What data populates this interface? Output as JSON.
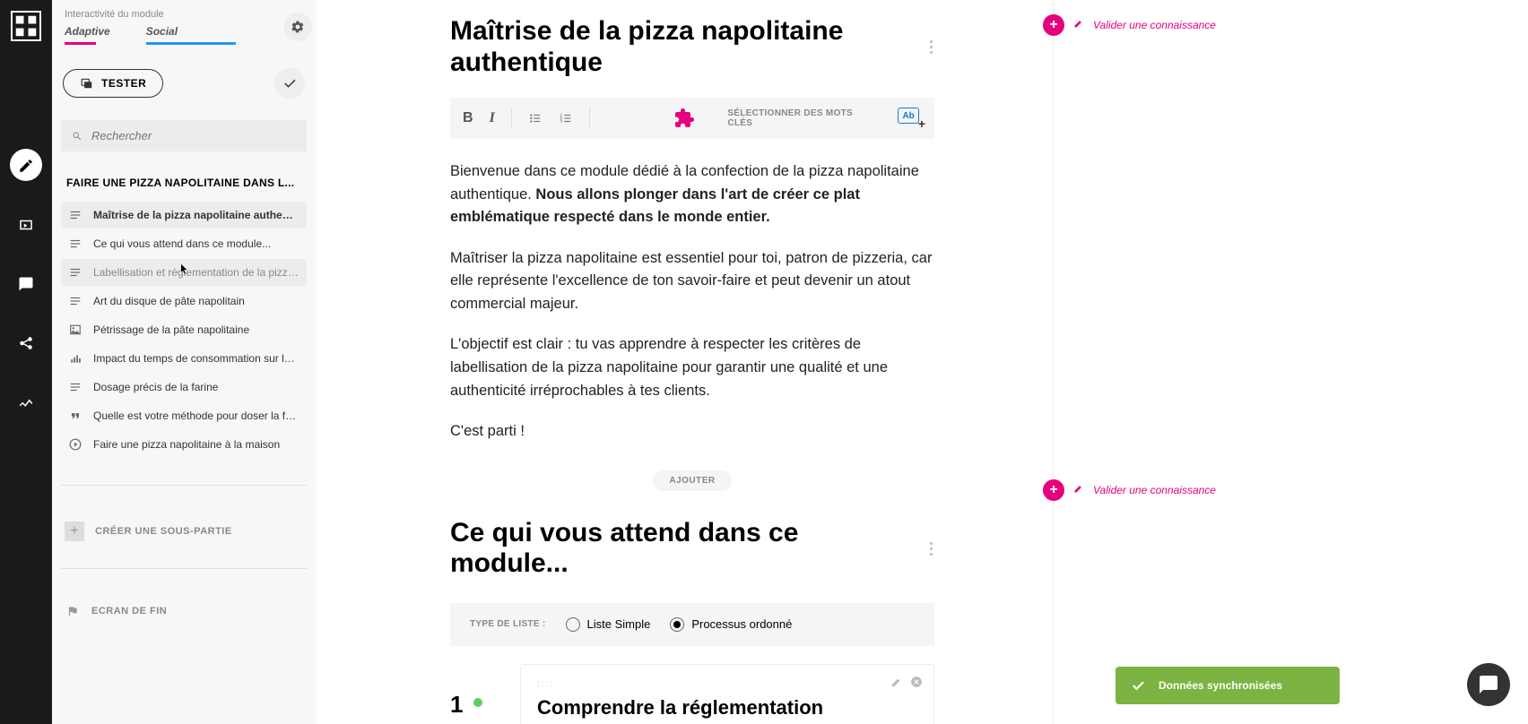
{
  "sidebar": {
    "interactivity_label": "Interactivité du module",
    "tabs": {
      "adaptive": "Adaptive",
      "social": "Social"
    },
    "tester_label": "TESTER",
    "search_placeholder": "Rechercher",
    "section_title": "FAIRE UNE PIZZA NAPOLITAINE DANS L...",
    "items": [
      {
        "label": "Maîtrise de la pizza napolitaine authentique",
        "icon": "text"
      },
      {
        "label": "Ce qui vous attend dans ce module...",
        "icon": "text"
      },
      {
        "label": "Labellisation et réglementation de la pizza n...",
        "icon": "text"
      },
      {
        "label": "Art du disque de pâte napolitain",
        "icon": "text"
      },
      {
        "label": "Pétrissage de la pâte napolitaine",
        "icon": "image"
      },
      {
        "label": "Impact du temps de consommation sur la piz...",
        "icon": "chart"
      },
      {
        "label": "Dosage précis de la farine",
        "icon": "text"
      },
      {
        "label": "Quelle est votre méthode pour doser la farine ?",
        "icon": "quote"
      },
      {
        "label": "Faire une pizza napolitaine à la maison",
        "icon": "play"
      }
    ],
    "create_subpart": "CRÉER UNE SOUS-PARTIE",
    "end_screen": "ECRAN DE FIN"
  },
  "main": {
    "block1": {
      "title": "Maîtrise de la pizza napolitaine authentique",
      "toolbar": {
        "select_keywords": "SÉLECTIONNER DES MOTS CLÉS",
        "hl_text": "Ab"
      },
      "para1_a": "Bienvenue dans ce module dédié à la confection de la pizza napolitaine authentique. ",
      "para1_b": "Nous allons plonger dans l'art de créer ce plat emblématique respecté dans le monde entier.",
      "para2": "Maîtriser la pizza napolitaine est essentiel pour toi, patron de pizzeria, car elle représente l'excellence de ton savoir-faire et peut devenir un atout commercial majeur.",
      "para3": "L'objectif est clair : tu vas apprendre à respecter les critères de labellisation de la pizza napolitaine pour garantir une qualité et une authenticité irréprochables à tes clients.",
      "para4": "C'est parti !"
    },
    "ajouter": "AJOUTER",
    "block2": {
      "title": "Ce qui vous attend dans ce module...",
      "list_type_label": "TYPE DE LISTE :",
      "opt1": "Liste Simple",
      "opt2": "Processus ordonné",
      "step_num": "1",
      "step_title": "Comprendre la réglementation"
    }
  },
  "right": {
    "validate_label": "Valider une connaissance"
  },
  "toast": {
    "label": "Données synchronisées"
  }
}
